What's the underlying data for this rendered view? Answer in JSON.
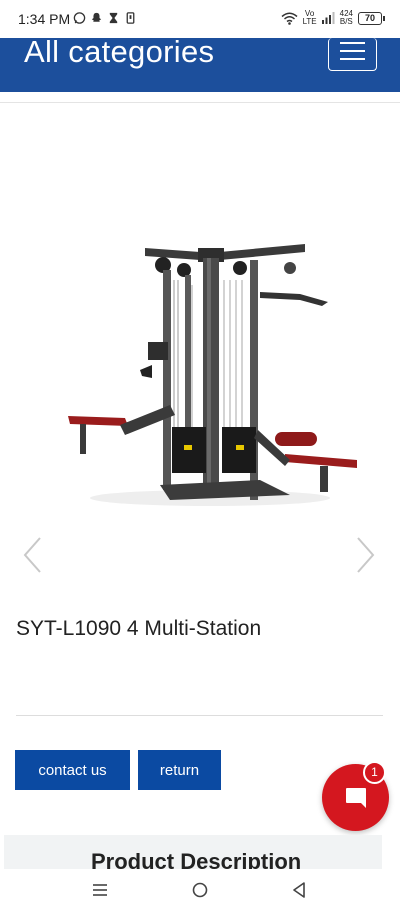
{
  "status_bar": {
    "time": "1:34 PM",
    "network_top": "Vo",
    "network_bottom": "LTE",
    "speed_top": "424",
    "speed_bottom": "B/S",
    "battery": "70"
  },
  "header": {
    "title": "All categories",
    "menu_icon": "hamburger-menu-icon",
    "background_color": "#1c4f9c"
  },
  "product": {
    "image_icon": "multi-station-gym-machine",
    "title": "SYT-L1090 4 Multi-Station"
  },
  "carousel": {
    "prev_icon": "chevron-left-icon",
    "next_icon": "chevron-right-icon"
  },
  "actions": {
    "contact_label": "contact us",
    "return_label": "return",
    "button_color": "#0b4aa2"
  },
  "chat": {
    "badge_count": "1",
    "icon": "chat-bubble-icon",
    "color": "#d4171f"
  },
  "description": {
    "title": "Product Description"
  },
  "nav_bar": {
    "recent_icon": "recent-apps-icon",
    "home_icon": "home-circle-icon",
    "back_icon": "back-triangle-icon"
  }
}
